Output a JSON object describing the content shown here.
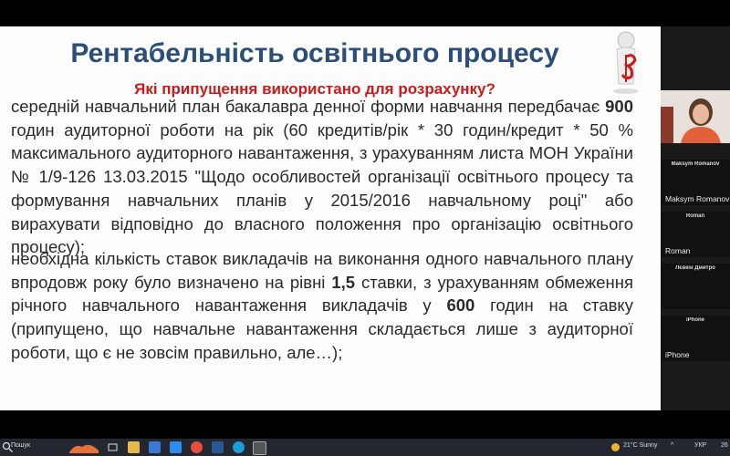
{
  "slide": {
    "title": "Рентабельність освітнього процесу",
    "subtitle": "Які припущення використано для розрахунку?",
    "p1": [
      {
        "t": "середній навчальний план бакалавра денної форми навчання передбачає ",
        "b": false
      },
      {
        "t": "900",
        "b": true
      },
      {
        "t": " годин аудиторної роботи на рік (60 кредитів/рік * 30 годин/кредит * 50 % максимального аудиторного навантаження, з урахуванням листа МОН України   № 1/9-126 13.03.2015 \"Щодо особливостей організації освітнього процесу та формування навчальних планів у 2015/2016 навчальному році\" або вирахувати відповідно до власного положення про організацію освітнього процесу);",
        "b": false
      }
    ],
    "p2": [
      {
        "t": "необхідна кількість ставок викладачів на виконання одного навчального плану впродовж року було визначено на рівні ",
        "b": false
      },
      {
        "t": "1,5",
        "b": true
      },
      {
        "t": " ставки, з урахуванням обмеження річного навчального навантаження викладачів у ",
        "b": false
      },
      {
        "t": "600",
        "b": true
      },
      {
        "t": " годин на ставку (припущено, що навчальне навантаження складається лише з аудиторної роботи, що є не зовсім правильно, але…);",
        "b": false
      }
    ]
  },
  "participants": [
    {
      "tag": "Maksym Romanov",
      "name": "Maksym Romanov"
    },
    {
      "tag": "Roman",
      "name": "Roman"
    },
    {
      "tag": "Лєвкін Дмитро",
      "name": ""
    },
    {
      "tag": "iPhone",
      "name": "iPhone"
    }
  ],
  "taskbar": {
    "search_label": "Пошук",
    "weather": "21°C  Sunny",
    "lang": "УКР",
    "date": "26"
  },
  "colors": {
    "title": "#2b4f7a",
    "subtitle": "#cc1a1a"
  }
}
